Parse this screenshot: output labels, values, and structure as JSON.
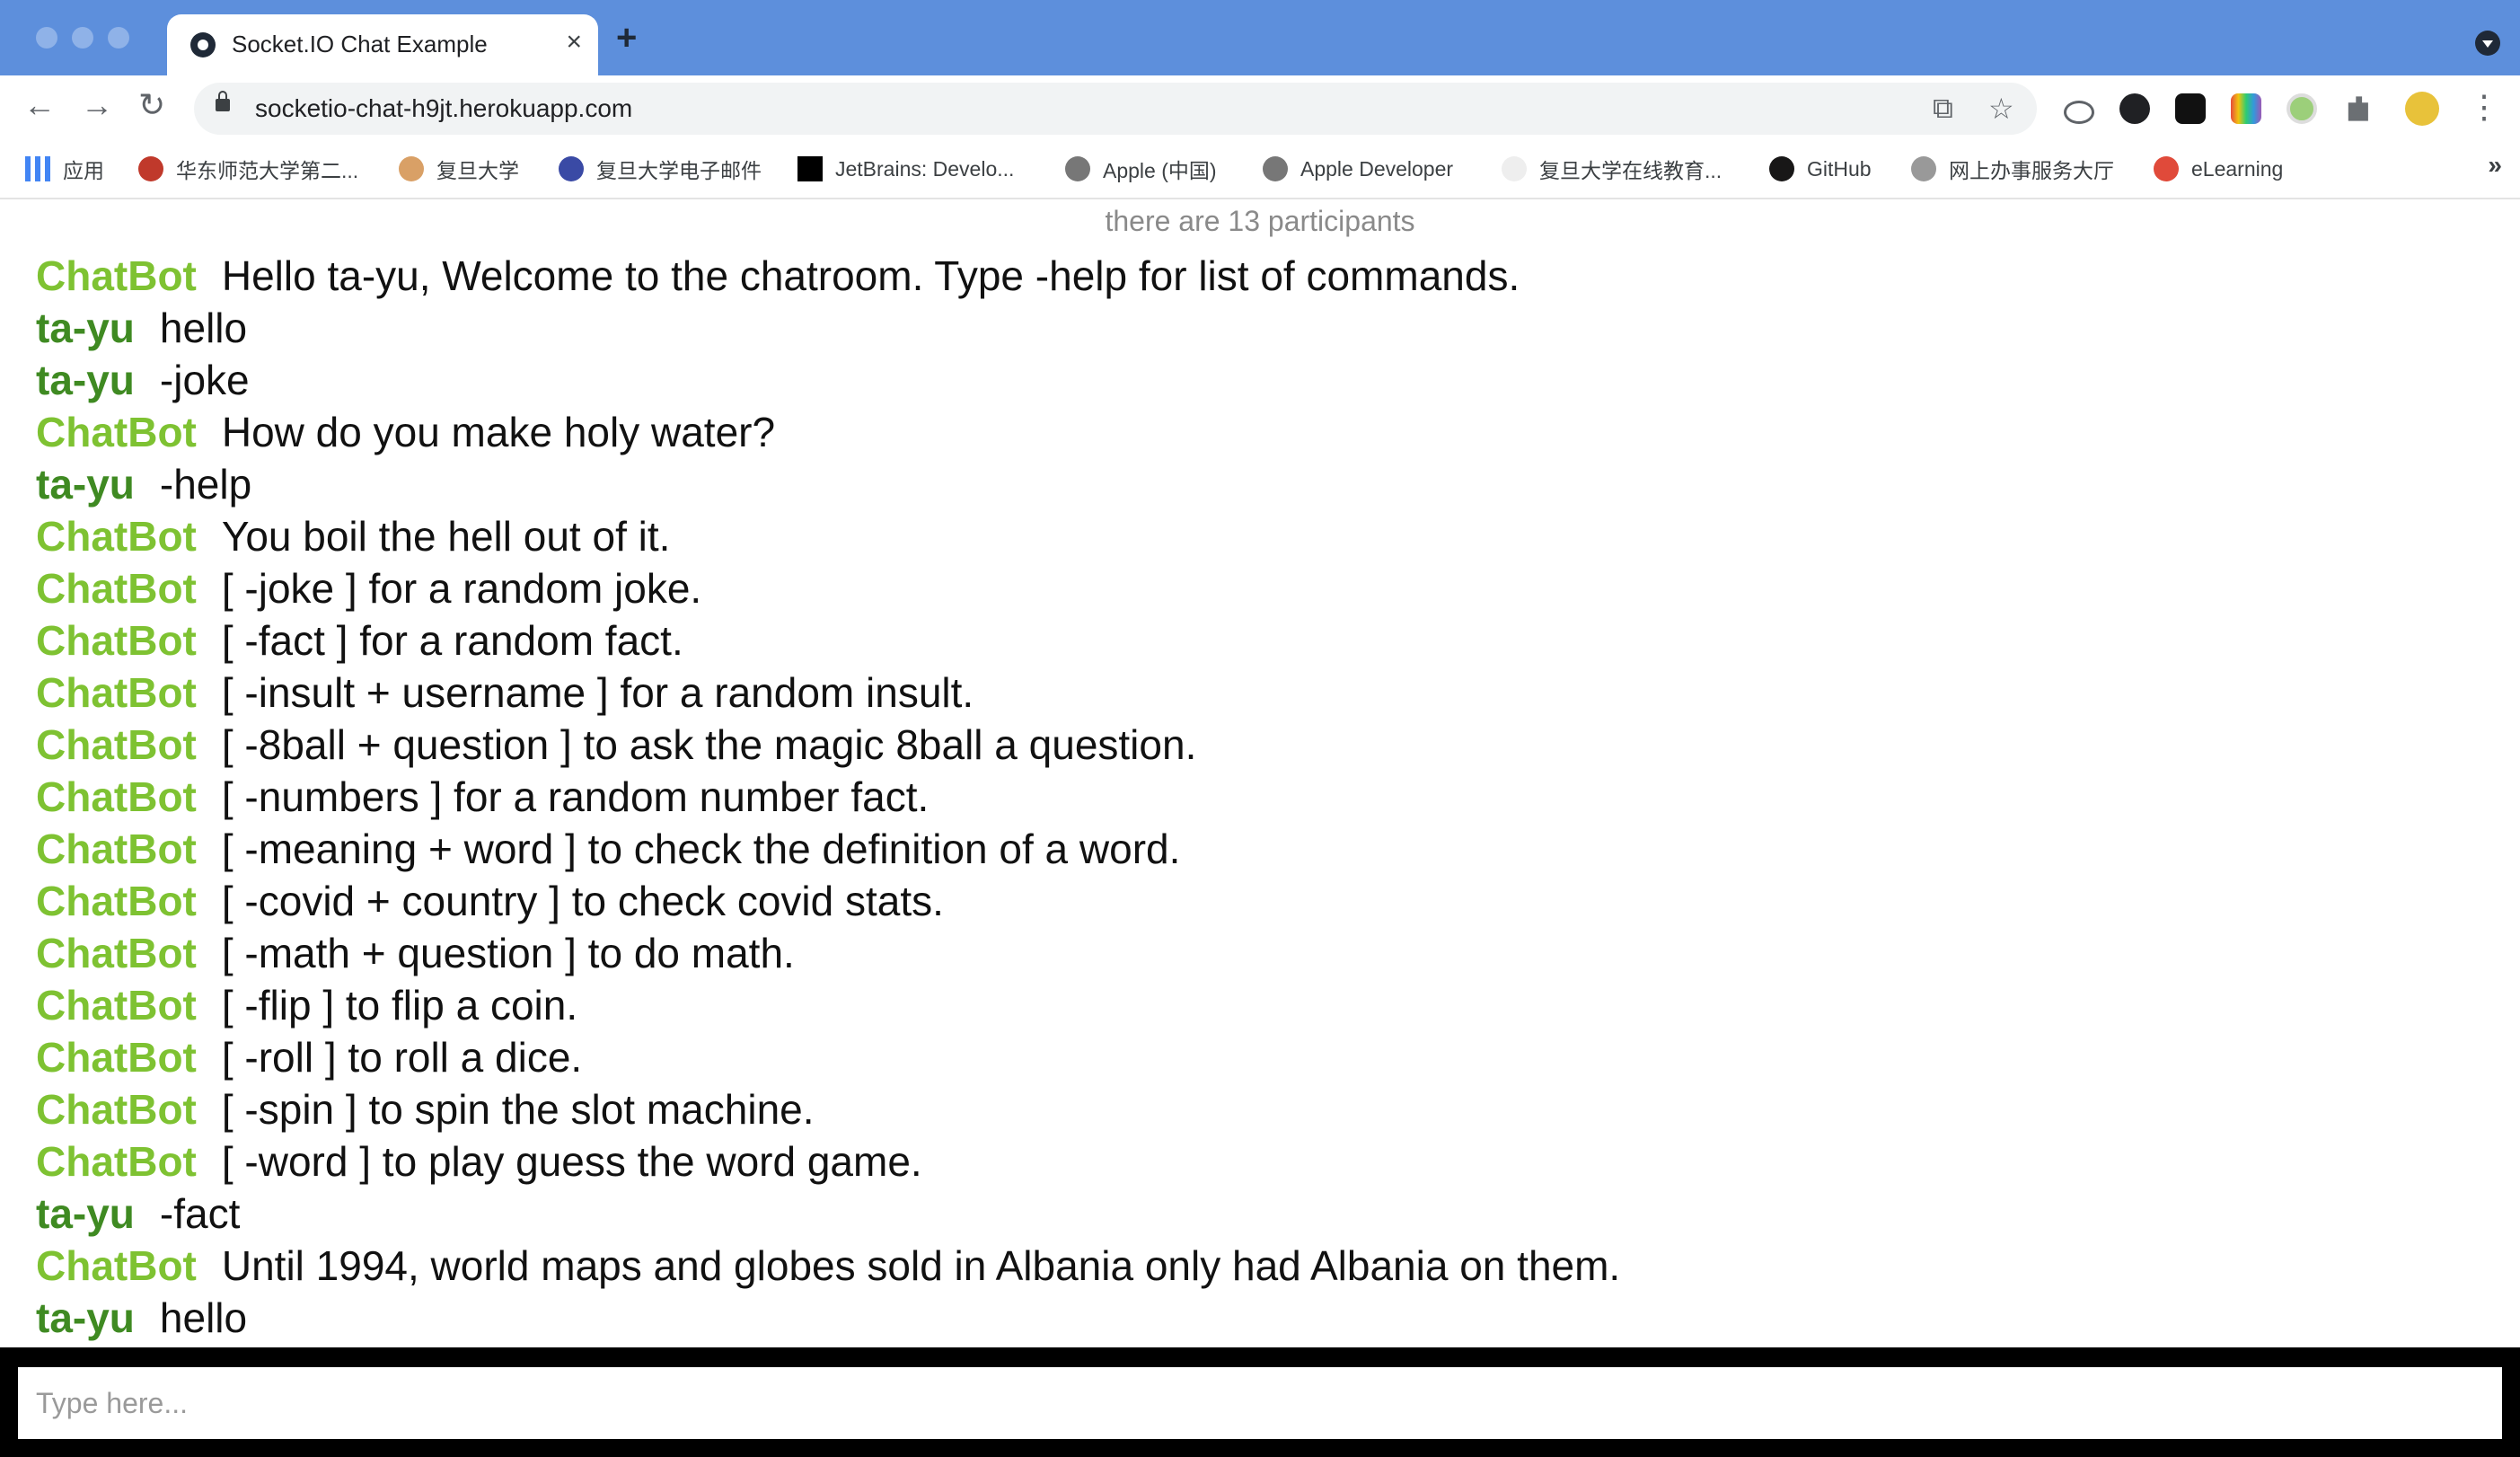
{
  "browser": {
    "tab_title": "Socket.IO Chat Example",
    "tab_close": "×",
    "new_tab": "+",
    "url": "socketio-chat-h9jt.herokuapp.com",
    "nav": {
      "back": "←",
      "forward": "→",
      "reload": "↻"
    },
    "omnibox_icons": {
      "translate": "⧉",
      "star": "☆"
    },
    "menu": "⋮"
  },
  "bookmarks": [
    {
      "label": "应用",
      "icon": "apps-grid-icon",
      "color": "#ea4335"
    },
    {
      "label": "华东师范大学第二...",
      "icon": "ecnu-icon",
      "color": "#c0392b"
    },
    {
      "label": "复旦大学",
      "icon": "fudan-icon",
      "color": "#d9a066"
    },
    {
      "label": "复旦大学电子邮件",
      "icon": "fudan-mail-icon",
      "color": "#3a4aa5"
    },
    {
      "label": "JetBrains: Develo...",
      "icon": "jetbrains-icon",
      "color": "#000000"
    },
    {
      "label": "Apple (中国)",
      "icon": "apple-icon",
      "color": "#777777"
    },
    {
      "label": "Apple Developer",
      "icon": "apple-icon",
      "color": "#777777"
    },
    {
      "label": "复旦大学在线教育...",
      "icon": "blank-page-icon",
      "color": "#eeeeee"
    },
    {
      "label": "GitHub",
      "icon": "github-icon",
      "color": "#181717"
    },
    {
      "label": "网上办事服务大厅",
      "icon": "house-icon",
      "color": "#999999"
    },
    {
      "label": "eLearning",
      "icon": "elearning-icon",
      "color": "#e04a3a"
    }
  ],
  "bookmarks_more": "»",
  "chat": {
    "participants_text": "there are 13 participants",
    "messages": [
      {
        "user": "ChatBot",
        "text": "Hello ta-yu, Welcome to the chatroom. Type -help for list of commands."
      },
      {
        "user": "ta-yu",
        "text": "hello"
      },
      {
        "user": "ta-yu",
        "text": "-joke"
      },
      {
        "user": "ChatBot",
        "text": "How do you make holy water?"
      },
      {
        "user": "ta-yu",
        "text": "-help"
      },
      {
        "user": "ChatBot",
        "text": "You boil the hell out of it."
      },
      {
        "user": "ChatBot",
        "text": "[ -joke ] for a random joke."
      },
      {
        "user": "ChatBot",
        "text": "[ -fact ] for a random fact."
      },
      {
        "user": "ChatBot",
        "text": "[ -insult + username ] for a random insult."
      },
      {
        "user": "ChatBot",
        "text": "[ -8ball + question ] to ask the magic 8ball a question."
      },
      {
        "user": "ChatBot",
        "text": "[ -numbers ] for a random number fact."
      },
      {
        "user": "ChatBot",
        "text": "[ -meaning + word ] to check the definition of a word."
      },
      {
        "user": "ChatBot",
        "text": "[ -covid + country ] to check covid stats."
      },
      {
        "user": "ChatBot",
        "text": "[ -math + question ] to do math."
      },
      {
        "user": "ChatBot",
        "text": "[ -flip ] to flip a coin."
      },
      {
        "user": "ChatBot",
        "text": "[ -roll ] to roll a dice."
      },
      {
        "user": "ChatBot",
        "text": "[ -spin ] to spin the slot machine."
      },
      {
        "user": "ChatBot",
        "text": "[ -word ] to play guess the word game."
      },
      {
        "user": "ta-yu",
        "text": "-fact"
      },
      {
        "user": "ChatBot",
        "text": "Until 1994, world maps and globes sold in Albania only had Albania on them."
      },
      {
        "user": "ta-yu",
        "text": "hello"
      }
    ],
    "input_placeholder": "Type here...",
    "input_value": ""
  },
  "colors": {
    "titlebar": "#5d8fdc",
    "bot_name": "#7ec232",
    "user_name": "#3f8a22"
  }
}
